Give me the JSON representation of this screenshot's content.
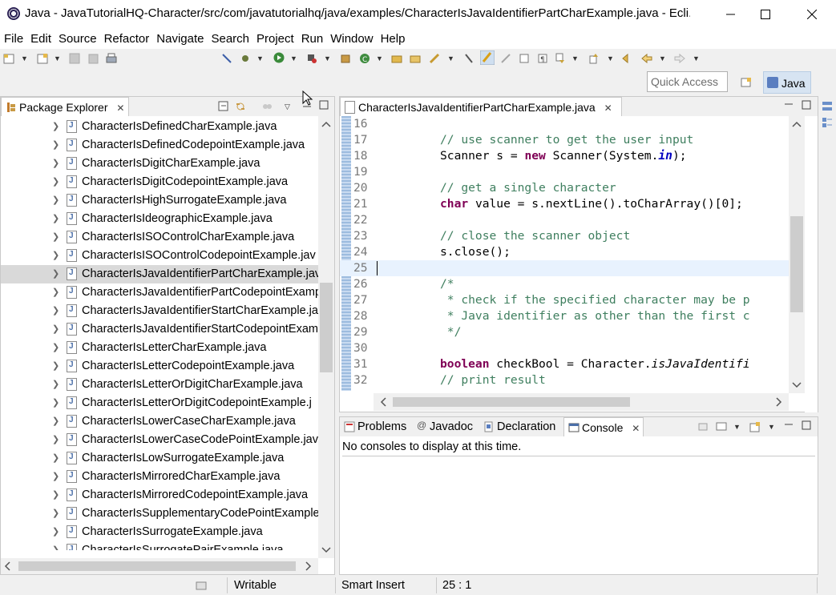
{
  "window": {
    "title": "Java - JavaTutorialHQ-Character/src/com/javatutorialhq/java/examples/CharacterIsJavaIdentifierPartCharExample.java - Ecli...",
    "minimize": "—",
    "maximize": "☐",
    "close": "✕"
  },
  "menu": [
    "File",
    "Edit",
    "Source",
    "Refactor",
    "Navigate",
    "Search",
    "Project",
    "Run",
    "Window",
    "Help"
  ],
  "toolbar": {
    "quick_access_placeholder": "Quick Access",
    "perspective": "Java"
  },
  "package_explorer": {
    "title": "Package Explorer",
    "files": [
      "CharacterIsDefinedCharExample.java",
      "CharacterIsDefinedCodepointExample.java",
      "CharacterIsDigitCharExample.java",
      "CharacterIsDigitCodepointExample.java",
      "CharacterIsHighSurrogateExample.java",
      "CharacterIsIdeographicExample.java",
      "CharacterIsISOControlCharExample.java",
      "CharacterIsISOControlCodepointExample.jav",
      "CharacterIsJavaIdentifierPartCharExample.jav",
      "CharacterIsJavaIdentifierPartCodepointExamp",
      "CharacterIsJavaIdentifierStartCharExample.ja",
      "CharacterIsJavaIdentifierStartCodepointExam",
      "CharacterIsLetterCharExample.java",
      "CharacterIsLetterCodepointExample.java",
      "CharacterIsLetterOrDigitCharExample.java",
      "CharacterIsLetterOrDigitCodepointExample.j",
      "CharacterIsLowerCaseCharExample.java",
      "CharacterIsLowerCaseCodePointExample.java",
      "CharacterIsLowSurrogateExample.java",
      "CharacterIsMirroredCharExample.java",
      "CharacterIsMirroredCodepointExample.java",
      "CharacterIsSupplementaryCodePointExample",
      "CharacterIsSurrogateExample.java",
      "CharacterIsSurrogatePairExample.java"
    ],
    "selected_index": 8
  },
  "editor": {
    "tab_title": "CharacterIsJavaIdentifierPartCharExample.java",
    "current_line": "25",
    "lines": [
      {
        "n": "16",
        "segs": [
          {
            "t": "",
            "c": ""
          }
        ]
      },
      {
        "n": "17",
        "segs": [
          {
            "t": "// use scanner to get the user input",
            "c": "cm"
          }
        ]
      },
      {
        "n": "18",
        "segs": [
          {
            "t": "Scanner s = ",
            "c": ""
          },
          {
            "t": "new",
            "c": "kw"
          },
          {
            "t": " Scanner(System.",
            "c": ""
          },
          {
            "t": "in",
            "c": "st"
          },
          {
            "t": ");",
            "c": ""
          }
        ]
      },
      {
        "n": "19",
        "segs": [
          {
            "t": "",
            "c": ""
          }
        ]
      },
      {
        "n": "20",
        "segs": [
          {
            "t": "// get a single character",
            "c": "cm"
          }
        ]
      },
      {
        "n": "21",
        "segs": [
          {
            "t": "char",
            "c": "kw"
          },
          {
            "t": " value = s.nextLine().toCharArray()[0];",
            "c": ""
          }
        ]
      },
      {
        "n": "22",
        "segs": [
          {
            "t": "",
            "c": ""
          }
        ]
      },
      {
        "n": "23",
        "segs": [
          {
            "t": "// close the scanner object",
            "c": "cm"
          }
        ]
      },
      {
        "n": "24",
        "segs": [
          {
            "t": "s.close();",
            "c": ""
          }
        ]
      },
      {
        "n": "25",
        "segs": [
          {
            "t": "",
            "c": ""
          }
        ]
      },
      {
        "n": "26",
        "segs": [
          {
            "t": "/*",
            "c": "cm"
          }
        ]
      },
      {
        "n": "27",
        "segs": [
          {
            "t": " * check if the specified character may be p",
            "c": "cm"
          }
        ]
      },
      {
        "n": "28",
        "segs": [
          {
            "t": " * Java identifier as other than the first c",
            "c": "cm"
          }
        ]
      },
      {
        "n": "29",
        "segs": [
          {
            "t": " */",
            "c": "cm"
          }
        ]
      },
      {
        "n": "30",
        "segs": [
          {
            "t": "",
            "c": ""
          }
        ]
      },
      {
        "n": "31",
        "segs": [
          {
            "t": "boolean",
            "c": "kw"
          },
          {
            "t": " checkBool = Character.",
            "c": ""
          },
          {
            "t": "isJavaIdentifi",
            "c": "it"
          }
        ]
      },
      {
        "n": "32",
        "segs": [
          {
            "t": "// print result",
            "c": "cm"
          }
        ]
      }
    ]
  },
  "bottom_panel": {
    "tabs": [
      "Problems",
      "Javadoc",
      "Declaration",
      "Console"
    ],
    "active_tab": "Console",
    "console_message": "No consoles to display at this time."
  },
  "status": {
    "writable": "Writable",
    "insert_mode": "Smart Insert",
    "position": "25 : 1"
  }
}
